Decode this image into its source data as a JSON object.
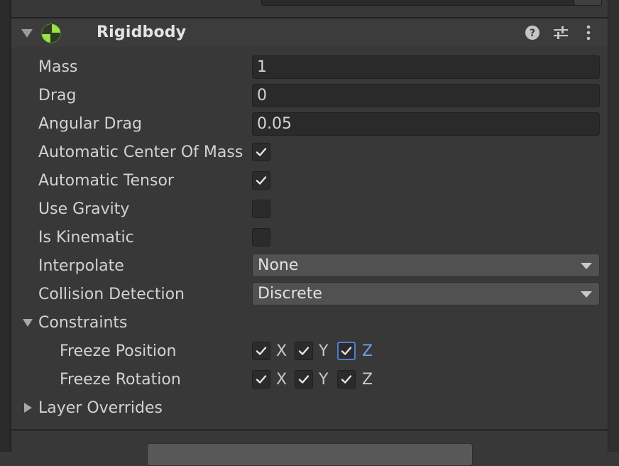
{
  "component": {
    "title": "Rigidbody",
    "icons": [
      "rigidbody-icon",
      "help-icon",
      "preset-icon",
      "more-icon"
    ]
  },
  "fields": {
    "mass": {
      "label": "Mass",
      "value": "1"
    },
    "drag": {
      "label": "Drag",
      "value": "0"
    },
    "angular_drag": {
      "label": "Angular Drag",
      "value": "0.05"
    },
    "automatic_center_of_mass": {
      "label": "Automatic Center Of Mass",
      "checked": true
    },
    "automatic_tensor": {
      "label": "Automatic Tensor",
      "checked": true
    },
    "use_gravity": {
      "label": "Use Gravity",
      "checked": false
    },
    "is_kinematic": {
      "label": "Is Kinematic",
      "checked": false
    },
    "interpolate": {
      "label": "Interpolate",
      "value": "None"
    },
    "collision_detection": {
      "label": "Collision Detection",
      "value": "Discrete"
    }
  },
  "constraints": {
    "label": "Constraints",
    "expanded": true,
    "freeze_position": {
      "label": "Freeze Position",
      "x": "X",
      "y": "Y",
      "z": "Z",
      "x_checked": true,
      "y_checked": true,
      "z_checked": true
    },
    "freeze_rotation": {
      "label": "Freeze Rotation",
      "x": "X",
      "y": "Y",
      "z": "Z",
      "x_checked": true,
      "y_checked": true,
      "z_checked": true
    }
  },
  "layer_overrides": {
    "label": "Layer Overrides",
    "expanded": false
  },
  "colors": {
    "background": "#383838",
    "field": "#2a2a2a",
    "dropdown": "#515151",
    "accent": "#4c7fd0",
    "rigidbody_icon": "#9be14a"
  }
}
